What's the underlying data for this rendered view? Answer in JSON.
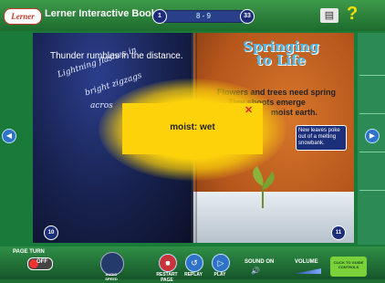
{
  "header": {
    "logo": "Lerner",
    "title": "Lerner Interactive Books",
    "page_start": "1",
    "page_range": "8 - 9",
    "page_end": "33",
    "help_label": "?"
  },
  "left_page": {
    "line1": "Thunder rumbles in the distance.",
    "line2": "Lightning flashes in",
    "line3": "bright zigzags",
    "line4": "acros",
    "page_number": "10"
  },
  "right_page": {
    "title_line1": "Springing",
    "title_line2": "to Life",
    "line1": "Flowers and trees need spring",
    "line2": "Tiny shoots emerge",
    "line3": "moist earth.",
    "caption": "New leaves poke out of a melting snowbank.",
    "page_number": "11"
  },
  "popup": {
    "text": "moist: wet",
    "close": "✕"
  },
  "nav": {
    "prev": "◀",
    "next": "▶"
  },
  "bottom": {
    "page_turn_label": "PAGE TURN",
    "page_turn_state": "OFF",
    "speed_label": "AUDIO SPEED",
    "restart_label": "RESTART PAGE",
    "replay_label": "REPLAY",
    "play_label": "PLAY",
    "sound_label": "SOUND ON",
    "volume_label": "VOLUME",
    "guide_label": "CLICK TO GUIDE CONTROLS",
    "icons": {
      "restart": "■",
      "replay": "↺",
      "play": "▷",
      "speaker": "🔊"
    }
  },
  "colors": {
    "popup": "#fdd20b",
    "frame_green": "#1a7a3a",
    "button_blue": "#2f73c8"
  }
}
